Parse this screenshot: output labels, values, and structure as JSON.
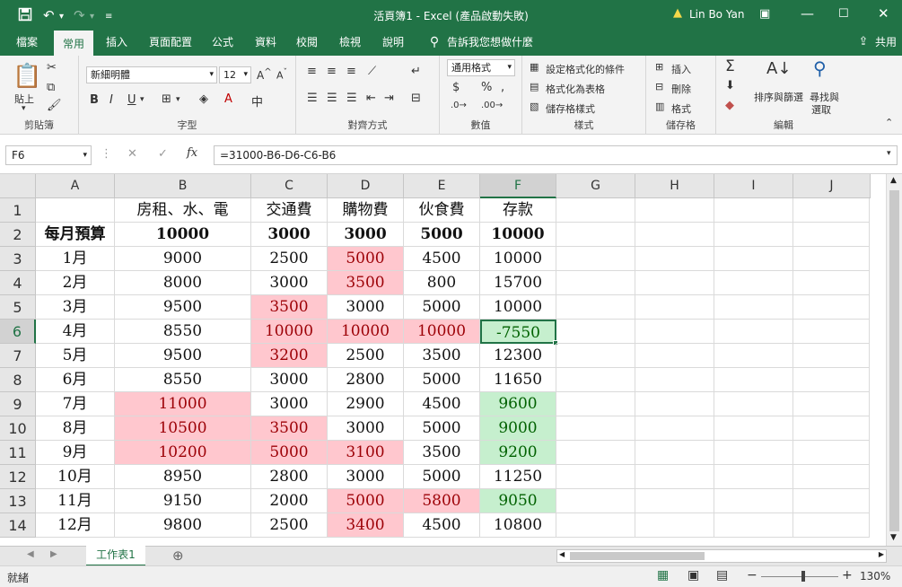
{
  "titlebar": {
    "title": "活頁簿1 - Excel (產品啟動失敗)",
    "user": "Lin Bo Yan",
    "save_icon": "save-icon",
    "undo_icon": "undo-icon",
    "redo_icon": "redo-icon"
  },
  "tabs": [
    "檔案",
    "常用",
    "插入",
    "頁面配置",
    "公式",
    "資料",
    "校閱",
    "檢視",
    "說明"
  ],
  "active_tab": "常用",
  "tell_me": "告訴我您想做什麼",
  "share": "共用",
  "ribbon": {
    "clipboard": {
      "paste": "貼上",
      "label": "剪貼簿"
    },
    "font": {
      "name": "新細明體",
      "size": "12",
      "label": "字型"
    },
    "alignment": {
      "label": "對齊方式"
    },
    "number": {
      "format": "通用格式",
      "label": "數值"
    },
    "styles": {
      "conditional": "設定格式化的條件",
      "as_table": "格式化為表格",
      "cell_styles": "儲存格樣式",
      "label": "樣式"
    },
    "cells": {
      "insert": "插入",
      "delete": "刪除",
      "format": "格式",
      "label": "儲存格"
    },
    "editing": {
      "sort_filter": "排序與篩選",
      "find_select_1": "尋找與",
      "find_select_2": "選取",
      "label": "編輯"
    }
  },
  "formula_bar": {
    "name_box": "F6",
    "formula": "=31000-B6-D6-C6-B6"
  },
  "grid": {
    "columns": [
      "A",
      "B",
      "C",
      "D",
      "E",
      "F",
      "G",
      "H",
      "I",
      "J"
    ],
    "rows": [
      [
        "",
        "房租、水、電",
        "交通費",
        "購物費",
        "伙食費",
        "存款"
      ],
      [
        "每月預算",
        "10000",
        "3000",
        "3000",
        "5000",
        "10000"
      ],
      [
        "1月",
        "9000",
        "2500",
        "5000",
        "4500",
        "10000"
      ],
      [
        "2月",
        "8000",
        "3000",
        "3500",
        "800",
        "15700"
      ],
      [
        "3月",
        "9500",
        "3500",
        "3000",
        "5000",
        "10000"
      ],
      [
        "4月",
        "8550",
        "10000",
        "10000",
        "10000",
        "-7550"
      ],
      [
        "5月",
        "9500",
        "3200",
        "2500",
        "3500",
        "12300"
      ],
      [
        "6月",
        "8550",
        "3000",
        "2800",
        "5000",
        "11650"
      ],
      [
        "7月",
        "11000",
        "3000",
        "2900",
        "4500",
        "9600"
      ],
      [
        "8月",
        "10500",
        "3500",
        "3000",
        "5000",
        "9000"
      ],
      [
        "9月",
        "10200",
        "5000",
        "3100",
        "3500",
        "9200"
      ],
      [
        "10月",
        "8950",
        "2800",
        "3000",
        "5000",
        "11250"
      ],
      [
        "11月",
        "9150",
        "2000",
        "5000",
        "5800",
        "9050"
      ],
      [
        "12月",
        "9800",
        "2500",
        "3400",
        "4500",
        "10800"
      ]
    ],
    "highlight_red": [
      "D3",
      "D4",
      "C5",
      "C6",
      "D6",
      "E6",
      "C7",
      "B9",
      "B10",
      "C10",
      "B11",
      "C11",
      "D11",
      "D13",
      "E13",
      "D14"
    ],
    "highlight_green": [
      "F6",
      "F9",
      "F10",
      "F11",
      "F13"
    ],
    "bold_row": 2,
    "active_cell": "F6",
    "colors": {
      "red_fill": "#ffc7ce",
      "red_text": "#9c0006",
      "green_fill": "#c6efce",
      "green_text": "#006100",
      "accent": "#217346"
    }
  },
  "sheet_tab": "工作表1",
  "status": {
    "ready": "就緒",
    "zoom": "130%"
  }
}
